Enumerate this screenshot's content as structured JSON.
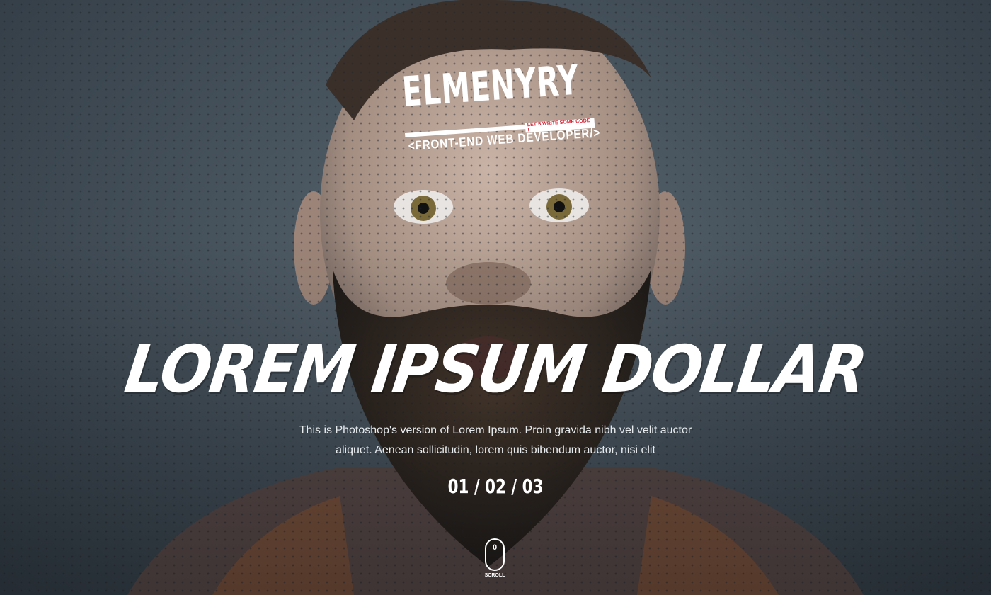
{
  "logo": {
    "name": "ELMENYRY",
    "tagline": "LET'S WRITE SOME CODE !",
    "subtitle": "<FRONT-END WEB DEVELOPER/>"
  },
  "hero": {
    "title": "LOREM IPSUM DOLLAR",
    "description": "This is Photoshop's version  of Lorem Ipsum. Proin gravida nibh vel velit auctor aliquet. Aenean sollicitudin, lorem quis bibendum auctor, nisi elit",
    "pager": "01 / 02 / 03"
  },
  "scroll": {
    "wheel": "0",
    "label": "SCROLL"
  },
  "colors": {
    "accent": "#d42030",
    "text": "#ffffff"
  }
}
